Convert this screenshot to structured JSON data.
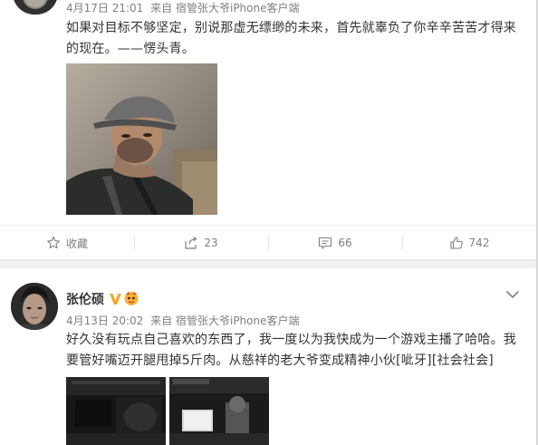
{
  "post1": {
    "meta": {
      "time": "4月17日 21:01",
      "source_prefix": "来自",
      "source": "宿管张大爷iPhone客户端"
    },
    "text_line1": "如果对目标不够坚定，别说那虚无缥缈的未来，首先就辜负了你辛辛苦苦才得来",
    "text_line2": "的现在。——愣头青。",
    "actions": {
      "favorite_label": "收藏",
      "repost_count": "23",
      "comment_count": "66",
      "like_count": "742"
    }
  },
  "post2": {
    "user_name": "张伦硕",
    "meta": {
      "time": "4月13日 20:02",
      "source_prefix": "来自",
      "source": "宿管张大爷iPhone客户端"
    },
    "text_line1": "好久没有玩点自己喜欢的东西了，我一度以为我快成为一个游戏主播了哈哈。我",
    "text_line2": "要管好嘴迈开腿甩掉5斤肉。从慈祥的老大爷变成精神小伙[呲牙][社会社会]"
  },
  "icons": {
    "favorite": "star-icon",
    "repost": "repost-icon",
    "comment": "comment-icon",
    "like": "thumbs-up-icon",
    "verified": "verified-v-icon",
    "expand": "chevron-down-icon"
  },
  "colors": {
    "text": "#333333",
    "meta": "#808080",
    "verified_orange": "#f6a623",
    "divider_gap": "#f2f2f5"
  }
}
